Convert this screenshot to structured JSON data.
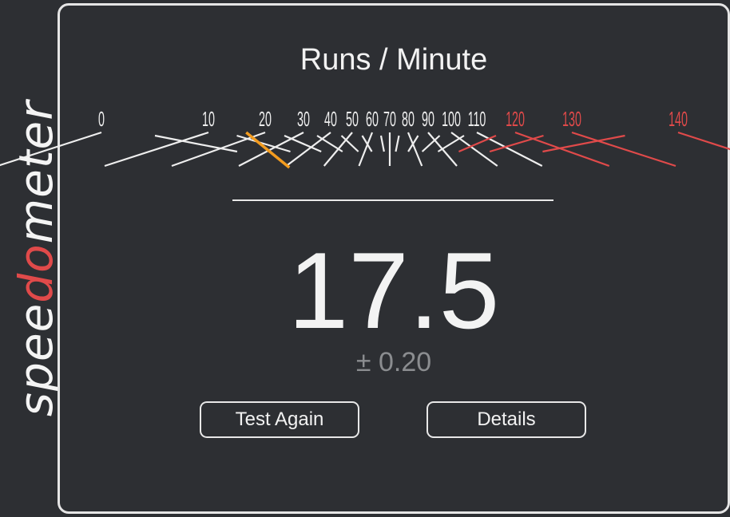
{
  "logo": {
    "prefix": "spee",
    "accent": "do",
    "suffix": "meter",
    "accent_color": "#e04a4a",
    "dial_icon": "speedometer-dial-icon"
  },
  "header": {
    "title": "Runs / Minute"
  },
  "gauge": {
    "tick_labels": [
      "0",
      "10",
      "20",
      "30",
      "40",
      "50",
      "60",
      "70",
      "80",
      "90",
      "100",
      "110",
      "120",
      "130",
      "140"
    ],
    "max": 140,
    "redline_from": 115,
    "needle_value": 17.5,
    "colors": {
      "ticks": "#eeeeee",
      "redline": "#e04a4a",
      "needle": "#f39c1f"
    }
  },
  "result": {
    "score": "17.5",
    "error": "± 0.20"
  },
  "buttons": {
    "test_again": "Test Again",
    "details": "Details"
  }
}
